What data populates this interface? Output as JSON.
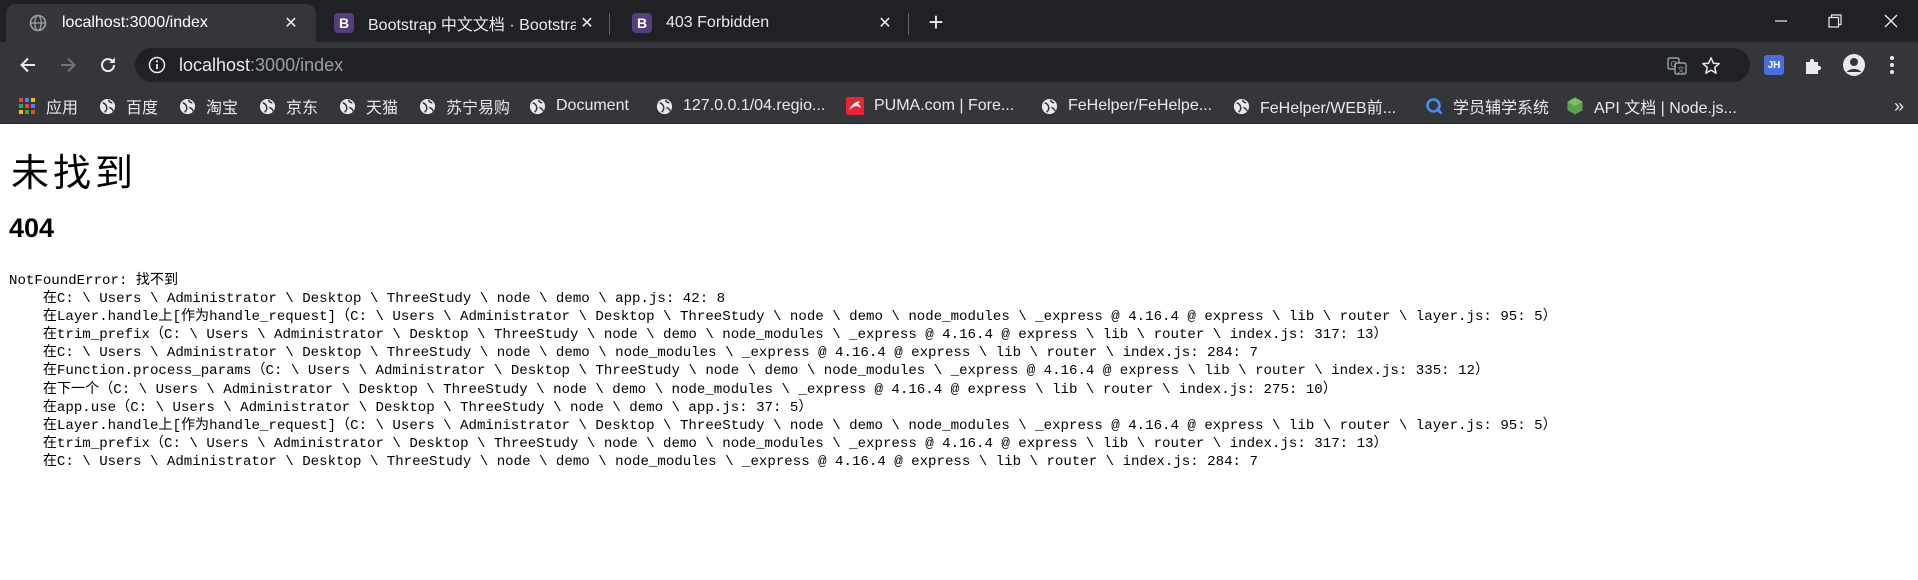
{
  "tabs": [
    {
      "title": "localhost:3000/index",
      "active": true,
      "favicon": "globe-icon"
    },
    {
      "title": "Bootstrap 中文文档 · Bootstrap",
      "active": false,
      "favicon": "bootstrap-icon"
    },
    {
      "title": "403 Forbidden",
      "active": false,
      "favicon": "bootstrap-icon"
    }
  ],
  "bootstrap_letter": "B",
  "new_tab_label": "+",
  "window_controls": [
    "minimize-icon",
    "restore-icon",
    "close-icon"
  ],
  "address": {
    "host": "localhost",
    "rest": ":3000/index"
  },
  "extension_jh": "JH",
  "bookmarks": [
    {
      "label": "应用",
      "icon": "apps-grid-icon"
    },
    {
      "label": "百度",
      "icon": "globe-icon"
    },
    {
      "label": "淘宝",
      "icon": "globe-icon"
    },
    {
      "label": "京东",
      "icon": "globe-icon"
    },
    {
      "label": "天猫",
      "icon": "globe-icon"
    },
    {
      "label": "苏宁易购",
      "icon": "globe-icon"
    },
    {
      "label": "Document",
      "icon": "globe-icon"
    },
    {
      "label": "127.0.0.1/04.regio...",
      "icon": "globe-icon"
    },
    {
      "label": "PUMA.com | Fore...",
      "icon": "puma-icon"
    },
    {
      "label": "FeHelper/FeHelpe...",
      "icon": "globe-icon"
    },
    {
      "label": "FeHelper/WEB前...",
      "icon": "globe-icon"
    },
    {
      "label": "学员辅学系统",
      "icon": "q-icon"
    },
    {
      "label": "API 文档 | Node.js...",
      "icon": "node-icon"
    }
  ],
  "bookmarks_overflow": "»",
  "page": {
    "heading": "未找到",
    "status": "404",
    "stack": "NotFoundError: 找不到\n    在C: \\ Users \\ Administrator \\ Desktop \\ ThreeStudy \\ node \\ demo \\ app.js: 42: 8\n    在Layer.handle上[作为handle_request]（C: \\ Users \\ Administrator \\ Desktop \\ ThreeStudy \\ node \\ demo \\ node_modules \\ _express @ 4.16.4 @ express \\ lib \\ router \\ layer.js: 95: 5）\n    在trim_prefix（C: \\ Users \\ Administrator \\ Desktop \\ ThreeStudy \\ node \\ demo \\ node_modules \\ _express @ 4.16.4 @ express \\ lib \\ router \\ index.js: 317: 13）\n    在C: \\ Users \\ Administrator \\ Desktop \\ ThreeStudy \\ node \\ demo \\ node_modules \\ _express @ 4.16.4 @ express \\ lib \\ router \\ index.js: 284: 7\n    在Function.process_params（C: \\ Users \\ Administrator \\ Desktop \\ ThreeStudy \\ node \\ demo \\ node_modules \\ _express @ 4.16.4 @ express \\ lib \\ router \\ index.js: 335: 12）\n    在下一个（C: \\ Users \\ Administrator \\ Desktop \\ ThreeStudy \\ node \\ demo \\ node_modules \\ _express @ 4.16.4 @ express \\ lib \\ router \\ index.js: 275: 10）\n    在app.use（C: \\ Users \\ Administrator \\ Desktop \\ ThreeStudy \\ node \\ demo \\ app.js: 37: 5）\n    在Layer.handle上[作为handle_request]（C: \\ Users \\ Administrator \\ Desktop \\ ThreeStudy \\ node \\ demo \\ node_modules \\ _express @ 4.16.4 @ express \\ lib \\ router \\ layer.js: 95: 5）\n    在trim_prefix（C: \\ Users \\ Administrator \\ Desktop \\ ThreeStudy \\ node \\ demo \\ node_modules \\ _express @ 4.16.4 @ express \\ lib \\ router \\ index.js: 317: 13）\n    在C: \\ Users \\ Administrator \\ Desktop \\ ThreeStudy \\ node \\ demo \\ node_modules \\ _express @ 4.16.4 @ express \\ lib \\ router \\ index.js: 284: 7"
  },
  "colors": {
    "tabstrip": "#202124",
    "toolbar": "#35363a",
    "omnibox": "#202124",
    "text_light": "#e8eaed",
    "bootstrap_purple": "#563d7c",
    "puma_red": "#e3262f",
    "node_green": "#5fa04e"
  }
}
